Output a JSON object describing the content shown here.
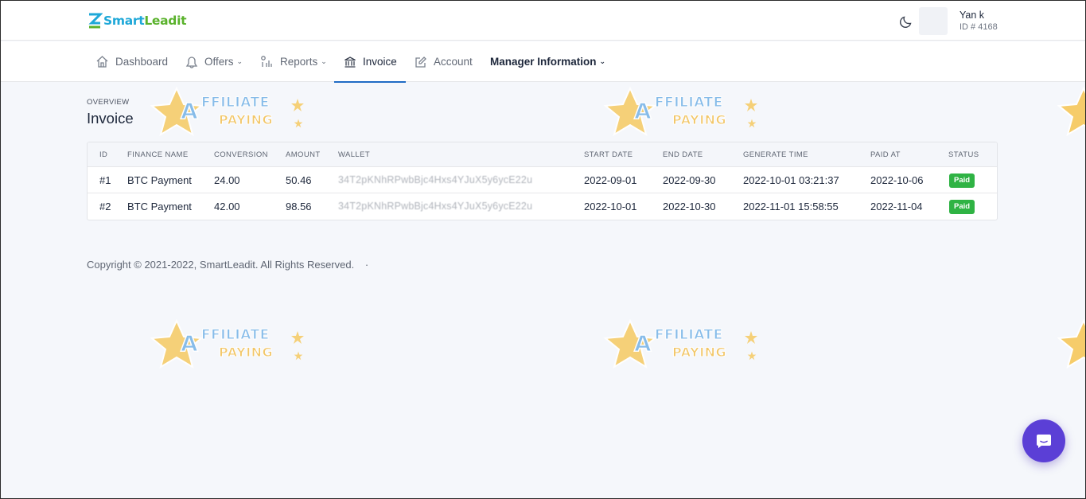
{
  "header": {
    "logo_smart": "Smart",
    "logo_leadit": "Leadit",
    "user_name": "Yan k",
    "user_id": "ID # 4168"
  },
  "nav": {
    "items": [
      {
        "label": "Dashboard",
        "icon": "home-icon"
      },
      {
        "label": "Offers",
        "icon": "offers-icon",
        "dropdown": true
      },
      {
        "label": "Reports",
        "icon": "reports-icon",
        "dropdown": true
      },
      {
        "label": "Invoice",
        "icon": "bank-icon",
        "active": true
      },
      {
        "label": "Account",
        "icon": "edit-icon"
      },
      {
        "label": "Manager Information",
        "dropdown": true
      }
    ]
  },
  "page": {
    "pretitle": "OVERVIEW",
    "title": "Invoice"
  },
  "table": {
    "columns": [
      "ID",
      "FINANCE NAME",
      "CONVERSION",
      "AMOUNT",
      "WALLET",
      "START DATE",
      "END DATE",
      "GENERATE TIME",
      "PAID AT",
      "STATUS"
    ],
    "rows": [
      {
        "id": "#1",
        "finance_name": "BTC Payment",
        "conversion": "24.00",
        "amount": "50.46",
        "wallet": "34T2pKNhRPwbBjc4Hxs4YJuX5y6ycE22u",
        "start_date": "2022-09-01",
        "end_date": "2022-09-30",
        "generate_time": "2022-10-01 03:21:37",
        "paid_at": "2022-10-06",
        "status": "Paid"
      },
      {
        "id": "#2",
        "finance_name": "BTC Payment",
        "conversion": "42.00",
        "amount": "98.56",
        "wallet": "34T2pKNhRPwbBjc4Hxs4YJuX5y6ycE22u",
        "start_date": "2022-10-01",
        "end_date": "2022-10-30",
        "generate_time": "2022-11-01 15:58:55",
        "paid_at": "2022-11-04",
        "status": "Paid"
      }
    ]
  },
  "footer": {
    "copyright": "Copyright © 2021-2022, SmartLeadit. All Rights Reserved.",
    "separator": "·"
  },
  "watermark": {
    "text_a": "A",
    "text_1": "FFILIATE",
    "text_2": "PAYING"
  },
  "colors": {
    "accent": "#206bc4",
    "paid_badge": "#2fb344",
    "chat_button": "#5b3fd6"
  }
}
